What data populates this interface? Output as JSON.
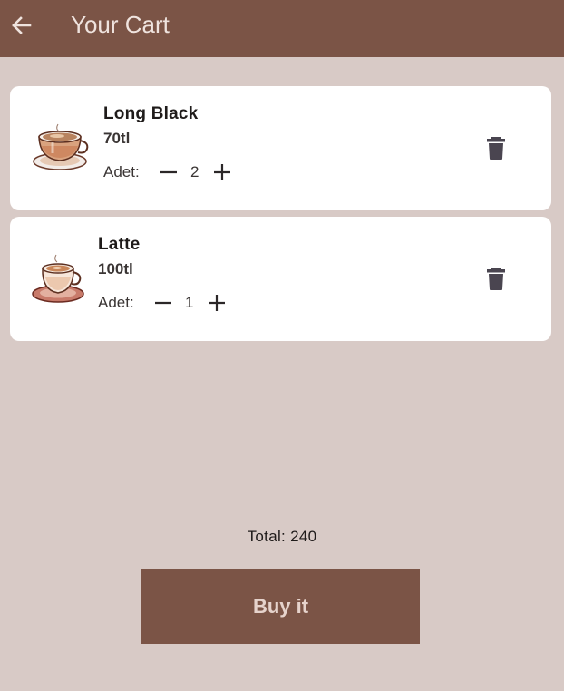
{
  "appbar": {
    "title": "Your Cart",
    "back_icon": "arrow-back-icon"
  },
  "cart": {
    "items": [
      {
        "name": "Long Black",
        "price": "70tl",
        "qty_label": "Adet:",
        "quantity": "2",
        "image_icon": "coffee-cup-icon",
        "delete_icon": "trash-icon"
      },
      {
        "name": "Latte",
        "price": "100tl",
        "qty_label": "Adet:",
        "quantity": "1",
        "image_icon": "latte-cup-icon",
        "delete_icon": "trash-icon"
      }
    ]
  },
  "footer": {
    "total": "Total: 240",
    "buy_label": "Buy it"
  },
  "colors": {
    "primary": "#7b5446",
    "background": "#d8cac6",
    "card": "#ffffff",
    "icon": "#4a4550"
  }
}
